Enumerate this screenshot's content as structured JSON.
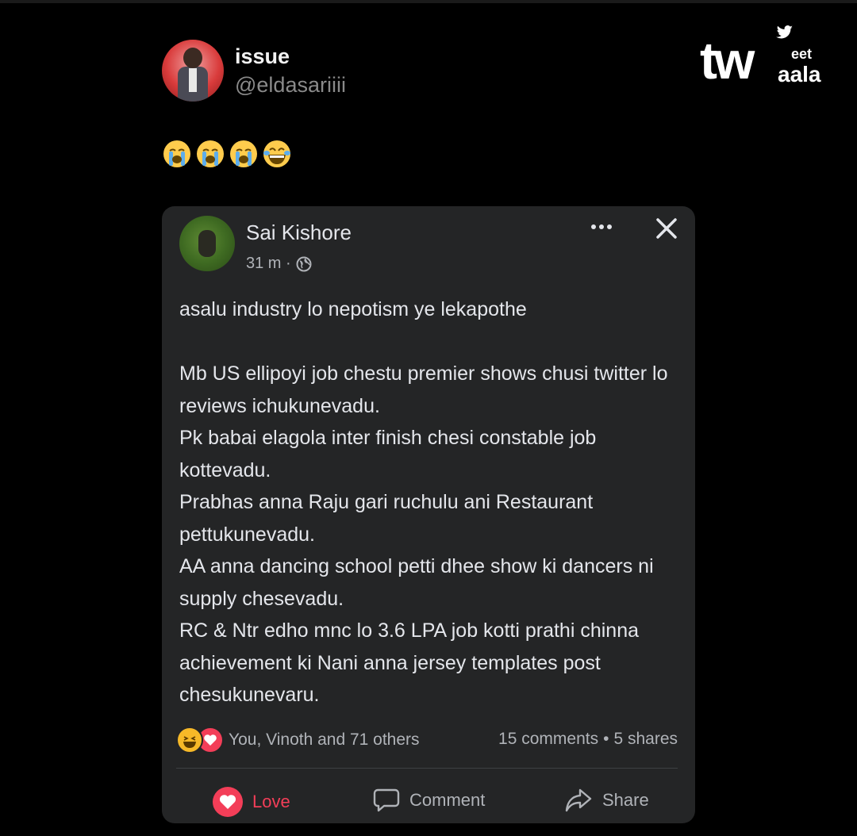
{
  "tweet": {
    "display_name": "issue",
    "handle": "@eldasariiii",
    "emojis": [
      "loudly-crying-face",
      "loudly-crying-face",
      "loudly-crying-face",
      "face-with-tears-of-joy"
    ]
  },
  "watermark": {
    "brand_tw": "tw",
    "brand_eet": "eet",
    "brand_aala": "aala",
    "icon": "twitter-bird-icon"
  },
  "fb_post": {
    "author": "Sai Kishore",
    "time": "31 m ·",
    "privacy_icon": "globe-icon",
    "paragraphs": [
      "asalu industry lo nepotism ye lekapothe",
      "",
      "Mb US ellipoyi job chestu premier shows chusi twitter lo reviews ichukunevadu.",
      "Pk babai elagola inter finish chesi constable job kottevadu.",
      "Prabhas anna Raju gari ruchulu ani Restaurant pettukunevadu.",
      "AA anna dancing school petti dhee show ki dancers ni supply chesevadu.",
      "RC & Ntr edho mnc lo 3.6 LPA job kotti prathi chinna achievement ki Nani anna jersey templates post chesukunevaru."
    ],
    "reactions_text": "You, Vinoth and 71 others",
    "comments": "15 comments",
    "separator": "•",
    "shares": "5 shares",
    "actions": {
      "love": "Love",
      "comment": "Comment",
      "share": "Share"
    }
  },
  "colors": {
    "background": "#000000",
    "card": "#242526",
    "text": "#e4e6eb",
    "muted": "#b0b3b8",
    "love": "#f33e58",
    "haha": "#f7b928"
  }
}
